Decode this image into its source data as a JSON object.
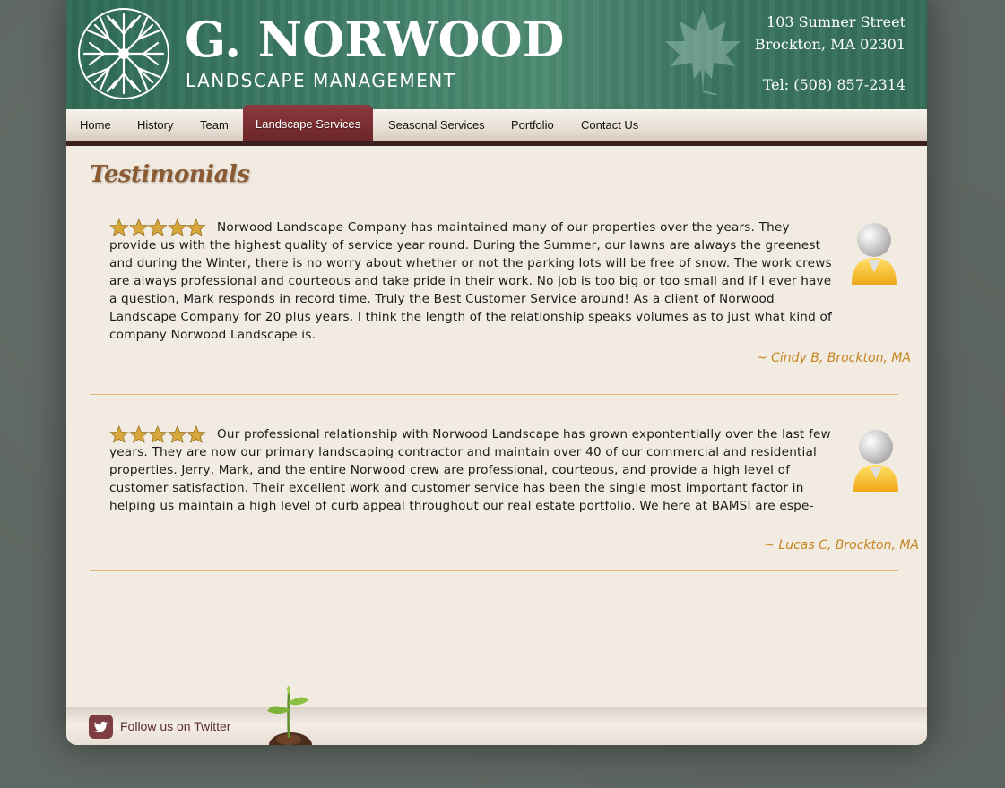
{
  "header": {
    "title": "G. NORWOOD",
    "subtitle": "LANDSCAPE MANAGEMENT",
    "address_line1": "103 Sumner Street",
    "address_line2": "Brockton, MA 02301",
    "phone": "Tel: (508) 857-2314"
  },
  "nav": {
    "items": [
      {
        "label": "Home"
      },
      {
        "label": "History"
      },
      {
        "label": "Team"
      },
      {
        "label": "Landscape Services"
      },
      {
        "label": "Seasonal Services"
      },
      {
        "label": "Portfolio"
      },
      {
        "label": "Contact Us"
      }
    ],
    "active": "Landscape Services"
  },
  "main": {
    "title": "Testimonials",
    "testimonials": [
      {
        "rating": 5,
        "text": "Norwood Landscape Company has maintained many of our properties over the years. They provide us with the highest quality of service year round.  During the Summer, our lawns are always the greenest and during the Winter, there is no worry about whether or not the parking lots will be free of snow.    The work crews are always professional and courteous and take pride in their work.  No job is too big or too small and if I ever have a question, Mark responds in record time.  Truly the Best Customer Service around! As a client of Norwood Landscape Company for 20 plus years, I think the length of the relationship speaks volumes as to just what kind of company Norwood Landscape is.",
        "author": "~ Cindy B, Brockton, MA"
      },
      {
        "rating": 5,
        "text": "Our professional relationship with Norwood Landscape has grown expontentially over the last few years. They are now our primary landscaping contractor and maintain over 40 of our commercial and residential properties. Jerry, Mark, and the entire Norwood crew are professional, courteous, and provide a high level of customer satisfaction. Their excellent work and customer service has been the single most important factor in helping us maintain a high level of curb appeal throughout our real estate portfolio. We here at BAMSI are espe-",
        "author": "~ Lucas C, Brockton, MA"
      }
    ]
  },
  "footer": {
    "twitter_label": "Follow us on Twitter"
  },
  "colors": {
    "header_green": "#3d7a63",
    "nav_active": "#7a2f33",
    "nav_border": "#3b1f1f",
    "author_gold": "#c48622",
    "divider": "#e2b978",
    "page_bg": "#f2ebe1"
  }
}
